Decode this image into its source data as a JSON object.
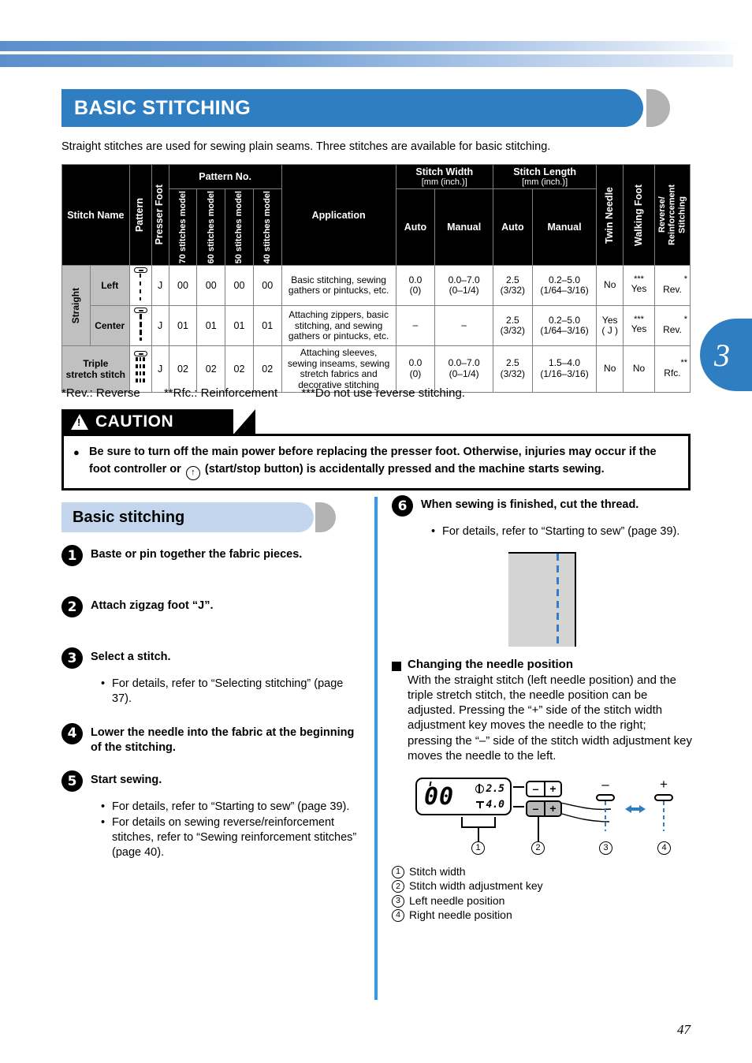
{
  "chapter_tab": "3",
  "page_number": "47",
  "heading": "BASIC STITCHING",
  "intro": "Straight stitches are used for sewing plain seams. Three stitches are available for basic stitching.",
  "table": {
    "headers": {
      "stitch_name": "Stitch Name",
      "pattern": "Pattern",
      "presser_foot": "Presser Foot",
      "pattern_no": "Pattern No.",
      "model_70": "70 stitches model",
      "model_60": "60 stitches model",
      "model_50": "50 stitches model",
      "model_40": "40 stitches model",
      "application": "Application",
      "stitch_width": "Stitch Width [mm (inch.)]",
      "stitch_width_l1": "Stitch Width",
      "stitch_width_l2": "[mm (inch.)]",
      "stitch_length_l1": "Stitch Length",
      "stitch_length_l2": "[mm (inch.)]",
      "auto": "Auto",
      "manual": "Manual",
      "twin_needle": "Twin Needle",
      "walking_foot": "Walking Foot",
      "reverse_reinforcement": "Reverse/ Reinforcement Stitching",
      "reverse_l1": "Reverse/",
      "reverse_l2": "Reinforcement",
      "reverse_l3": "Stitching"
    },
    "group_label": "Straight",
    "rows": [
      {
        "name": "Left",
        "presser_foot": "J",
        "p70": "00",
        "p60": "00",
        "p50": "00",
        "p40": "00",
        "application": "Basic stitching, sewing gathers or pintucks, etc.",
        "width_auto_l1": "0.0",
        "width_auto_l2": "(0)",
        "width_manual_l1": "0.0–7.0",
        "width_manual_l2": "(0–1/4)",
        "length_auto_l1": "2.5",
        "length_auto_l2": "(3/32)",
        "length_manual_l1": "0.2–5.0",
        "length_manual_l2": "(1/64–3/16)",
        "twin_needle": "No",
        "walking_foot_mark": "***",
        "walking_foot": "Yes",
        "reverse_mark": "*",
        "reverse": "Rev."
      },
      {
        "name": "Center",
        "presser_foot": "J",
        "p70": "01",
        "p60": "01",
        "p50": "01",
        "p40": "01",
        "application": "Attaching zippers, basic stitching, and sewing gathers or pintucks, etc.",
        "width_auto_l1": "–",
        "width_auto_l2": "",
        "width_manual_l1": "–",
        "width_manual_l2": "",
        "length_auto_l1": "2.5",
        "length_auto_l2": "(3/32)",
        "length_manual_l1": "0.2–5.0",
        "length_manual_l2": "(1/64–3/16)",
        "twin_needle_l1": "Yes",
        "twin_needle_l2": "( J )",
        "walking_foot_mark": "***",
        "walking_foot": "Yes",
        "reverse_mark": "*",
        "reverse": "Rev."
      },
      {
        "name": "Triple stretch stitch",
        "name_l1": "Triple",
        "name_l2": "stretch stitch",
        "presser_foot": "J",
        "p70": "02",
        "p60": "02",
        "p50": "02",
        "p40": "02",
        "application": "Attaching sleeves, sewing inseams, sewing stretch fabrics and decorative stitching",
        "width_auto_l1": "0.0",
        "width_auto_l2": "(0)",
        "width_manual_l1": "0.0–7.0",
        "width_manual_l2": "(0–1/4)",
        "length_auto_l1": "2.5",
        "length_auto_l2": "(3/32)",
        "length_manual_l1": "1.5–4.0",
        "length_manual_l2": "(1/16–3/16)",
        "twin_needle": "No",
        "walking_foot_mark": "",
        "walking_foot": "No",
        "reverse_mark": "**",
        "reverse": "Rfc."
      }
    ]
  },
  "footnotes": {
    "f1": "*Rev.: Reverse",
    "f2": "**Rfc.: Reinforcement",
    "f3": "***Do not use reverse stitching."
  },
  "caution": {
    "label": "CAUTION",
    "bullet": "●",
    "text_part1": "Be sure to turn off the main power before replacing the presser foot. Otherwise, injuries may occur if the foot controller or",
    "button_glyph": "↑",
    "text_part2": "(start/stop button) is accidentally pressed and the machine starts sewing."
  },
  "section": {
    "title": "Basic stitching",
    "steps": [
      {
        "num": "1",
        "title": "Baste or pin together the fabric pieces.",
        "bullets": []
      },
      {
        "num": "2",
        "title": "Attach zigzag foot “J”.",
        "bullets": []
      },
      {
        "num": "3",
        "title": "Select a stitch.",
        "bullets": [
          "For details, refer to “Selecting stitching” (page 37)."
        ]
      },
      {
        "num": "4",
        "title": "Lower the needle into the fabric at the beginning of the stitching.",
        "bullets": []
      },
      {
        "num": "5",
        "title": "Start sewing.",
        "bullets": [
          "For details, refer to “Starting to sew” (page 39).",
          "For details on sewing reverse/reinforcement stitches, refer to “Sewing reinforcement stitches” (page 40)."
        ]
      }
    ],
    "step6": {
      "num": "6",
      "title": "When sewing is finished, cut the thread.",
      "bullets": [
        "For details, refer to “Starting to sew” (page 39)."
      ]
    }
  },
  "needle_position": {
    "title": "Changing the needle position",
    "body": "With the straight stitch (left needle position) and the triple stretch stitch, the needle position can be adjusted. Pressing the “+” side of the stitch width adjustment key moves the needle to the right; pressing the “–” side of the stitch width adjustment key moves the needle to the left.",
    "lcd": {
      "pattern": "00",
      "width_value": "2.5",
      "length_value": "4.0",
      "minus": "–",
      "plus": "+"
    },
    "left_sign": "–",
    "right_sign": "+",
    "callouts": [
      {
        "num": "1",
        "label": "Stitch width"
      },
      {
        "num": "2",
        "label": "Stitch width adjustment key"
      },
      {
        "num": "3",
        "label": "Left needle position"
      },
      {
        "num": "4",
        "label": "Right needle position"
      }
    ]
  }
}
